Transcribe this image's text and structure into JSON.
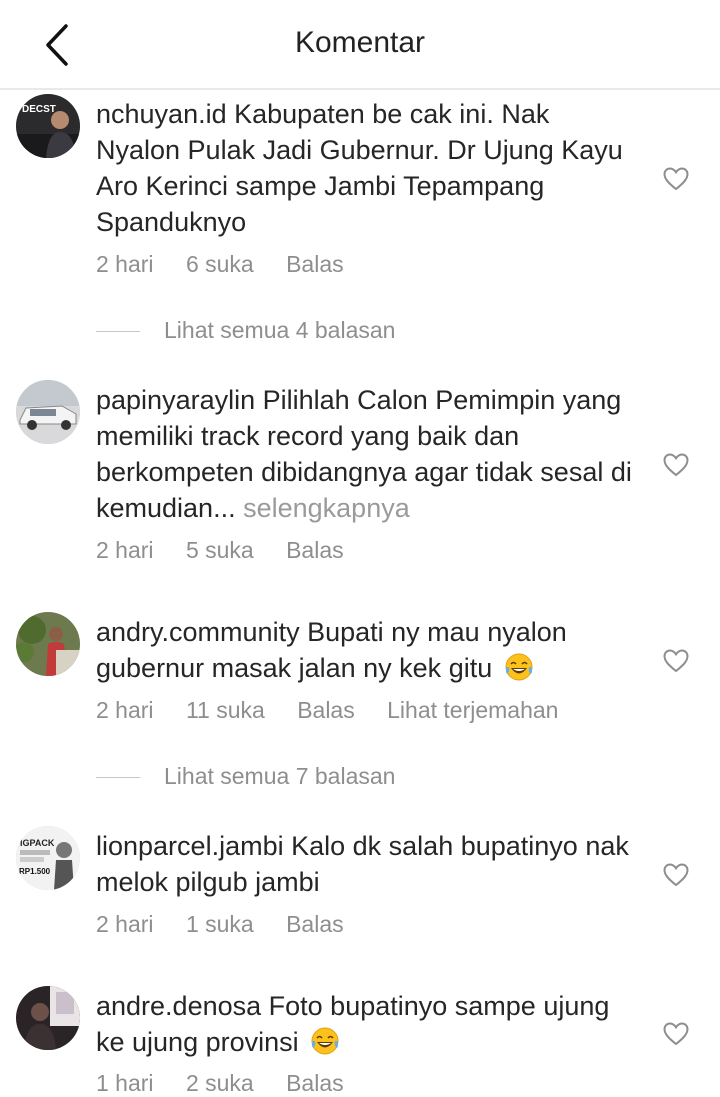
{
  "header": {
    "title": "Komentar",
    "back_icon": "chevron-left-icon"
  },
  "comments": [
    {
      "username": "nchuyan.id",
      "text": "Kabupaten be cak ini. Nak Nyalon Pulak Jadi Gubernur. Dr Ujung Kayu Aro Kerinci sampe Jambi Tepampang Spanduknyo",
      "time": "2 hari",
      "likes": "6 suka",
      "reply": "Balas",
      "view_replies": "Lihat semua 4 balasan"
    },
    {
      "username": "papinyaraylin",
      "text": "Pilihlah Calon Pemimpin yang memiliki track record yang baik dan berkompeten dibidangnya agar tidak sesal di kemudian...",
      "more": "selengkapnya",
      "time": "2 hari",
      "likes": "5 suka",
      "reply": "Balas"
    },
    {
      "username": "andry.community",
      "text": "Bupati ny mau nyalon gubernur masak jalan ny kek gitu",
      "time": "2 hari",
      "likes": "11 suka",
      "reply": "Balas",
      "translate": "Lihat terjemahan",
      "view_replies": "Lihat semua 7 balasan"
    },
    {
      "username": "lionparcel.jambi",
      "text": "Kalo dk salah bupatinyo nak melok pilgub jambi",
      "time": "2 hari",
      "likes": "1 suka",
      "reply": "Balas"
    },
    {
      "username": "andre.denosa",
      "text": "Foto bupatinyo sampe ujung ke ujung provinsi",
      "time": "1 hari",
      "likes": "2 suka",
      "reply": "Balas"
    }
  ],
  "avatar_texts": {
    "a1": "DECST",
    "a4_top": "IGPACK",
    "a4_price": "RP1.500"
  },
  "icons": {
    "like": "heart-outline-icon",
    "emoji": "laughing-tears-emoji"
  },
  "colors": {
    "text": "#262626",
    "secondary": "#8e8e8e",
    "divider": "#e9e9e9"
  }
}
